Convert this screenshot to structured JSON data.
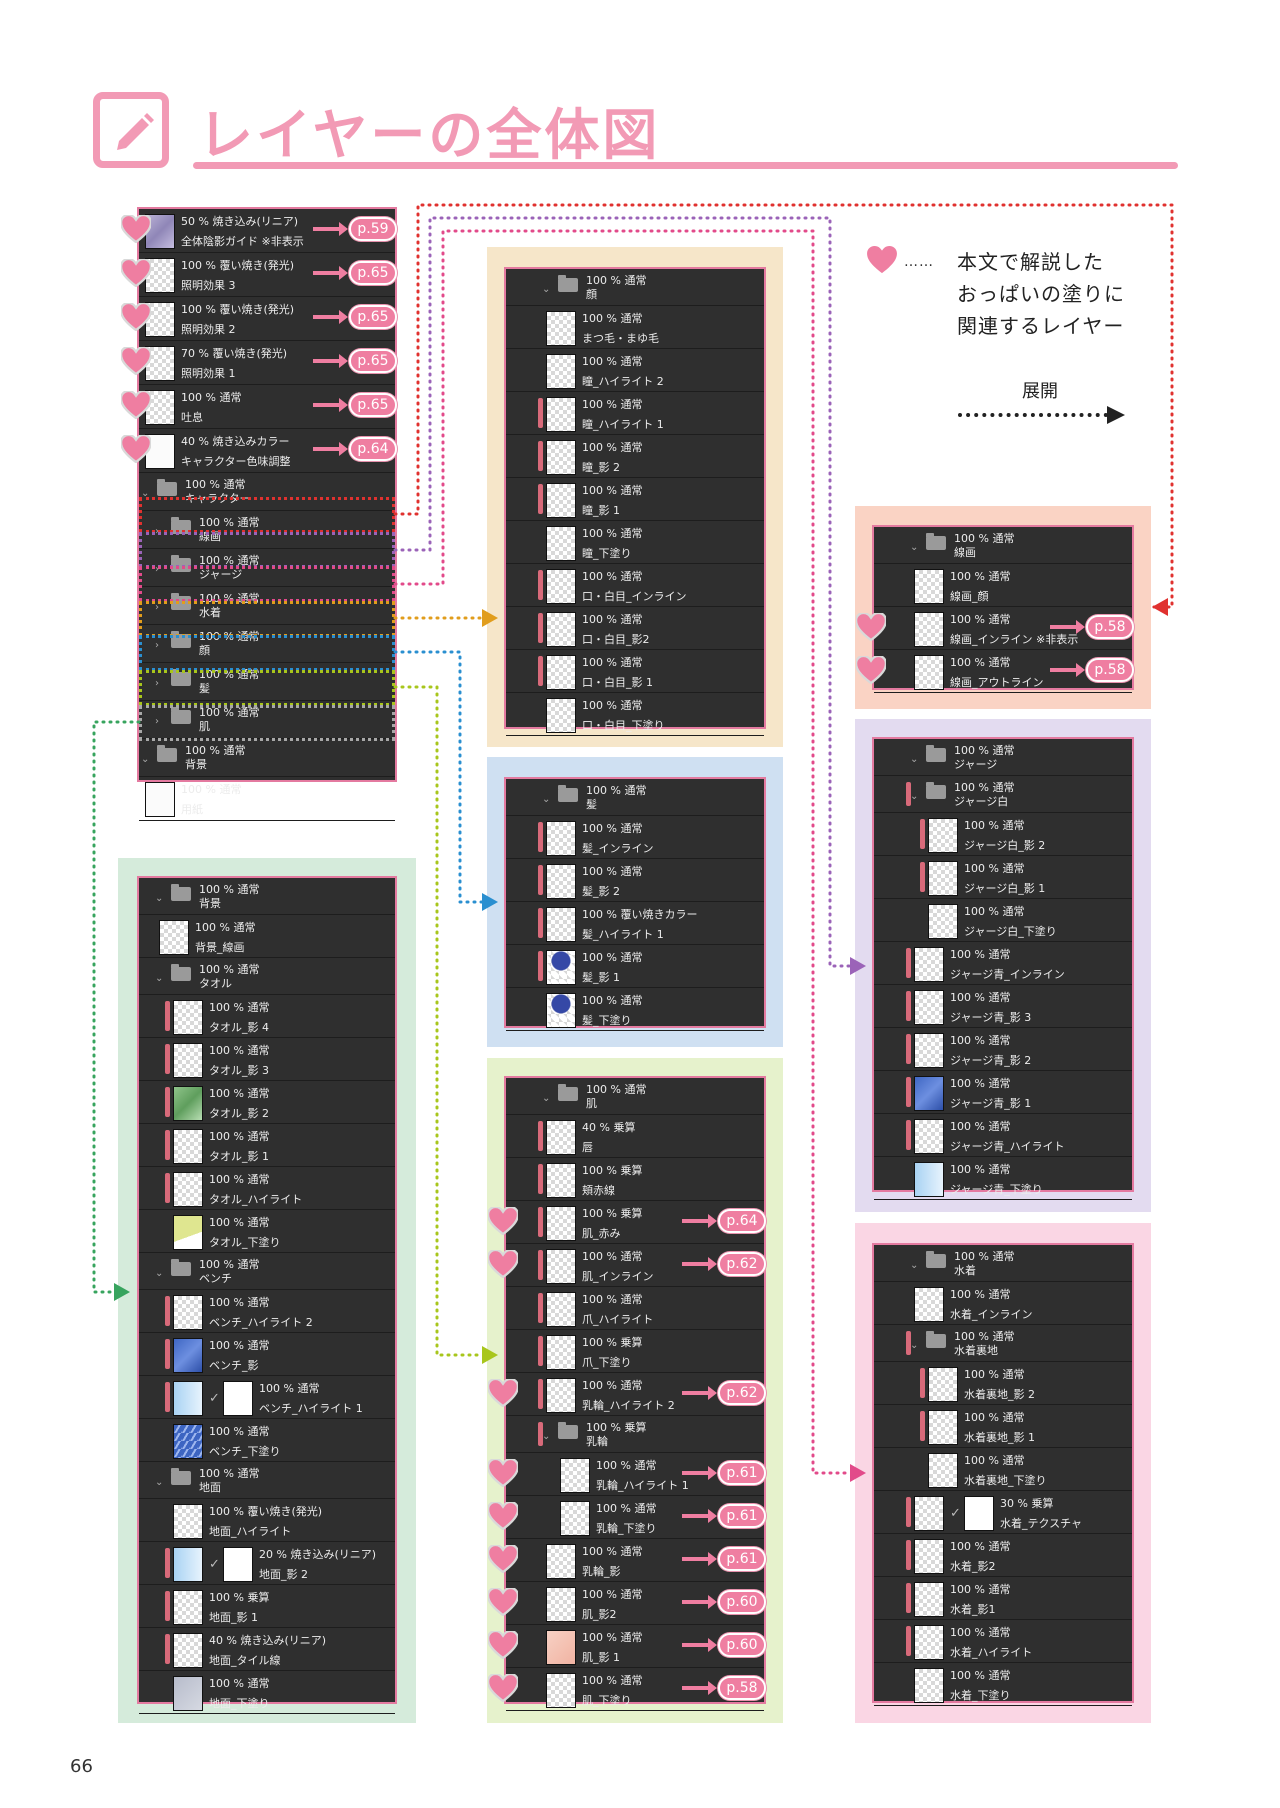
{
  "page": {
    "title": "レイヤーの全体図",
    "page_number": "66"
  },
  "legend": {
    "heart_icon": "heart-icon",
    "dots": "……",
    "lines": [
      "本文で解説した",
      "おっぱいの塗りに",
      "関連するレイヤー"
    ],
    "expand_label": "展開"
  },
  "colors": {
    "accent_pink": "#f29ab5",
    "panel_bg": "#2f2f2f",
    "clip_mark": "#d86a7a",
    "conn_senga": "#e0312f",
    "conn_jersey": "#9b63b8",
    "conn_mizugi": "#e24a8a",
    "conn_kao": "#e19d1c",
    "conn_kami": "#2a8fd0",
    "conn_hada": "#a8c61c",
    "conn_haikei": "#37a45e"
  },
  "main_panel": {
    "rows": [
      {
        "t1": "50 % 焼き込み(リニア)",
        "t2": "全体陰影ガイド ※非表示",
        "thumb": "lav",
        "heart": true,
        "ref": "p.59"
      },
      {
        "t1": "100 % 覆い焼き(発光)",
        "t2": "照明効果 3",
        "thumb": "check",
        "heart": true,
        "ref": "p.65"
      },
      {
        "t1": "100 % 覆い焼き(発光)",
        "t2": "照明効果 2",
        "thumb": "check",
        "heart": true,
        "ref": "p.65"
      },
      {
        "t1": "70 % 覆い焼き(発光)",
        "t2": "照明効果 1",
        "thumb": "check",
        "heart": true,
        "ref": "p.65"
      },
      {
        "t1": "100 % 通常",
        "t2": "吐息",
        "thumb": "check",
        "heart": true,
        "ref": "p.65"
      },
      {
        "t1": "40 % 焼き込みカラー",
        "t2": "キャラクター色味調整",
        "thumb": "white",
        "heart": true,
        "ref": "p.64"
      },
      {
        "t1": "100 % 通常",
        "t2": "キャラクター",
        "folder": true,
        "open": true
      },
      {
        "t1": "100 % 通常",
        "t2": "線画",
        "folder": true,
        "sub": true
      },
      {
        "t1": "100 % 通常",
        "t2": "ジャージ",
        "folder": true,
        "sub": true
      },
      {
        "t1": "100 % 通常",
        "t2": "水着",
        "folder": true,
        "sub": true
      },
      {
        "t1": "100 % 通常",
        "t2": "顔",
        "folder": true,
        "sub": true
      },
      {
        "t1": "100 % 通常",
        "t2": "髪",
        "folder": true,
        "sub": true
      },
      {
        "t1": "100 % 通常",
        "t2": "肌",
        "folder": true,
        "sub": true
      },
      {
        "t1": "100 % 通常",
        "t2": "背景",
        "folder": true
      },
      {
        "t1": "100 % 通常",
        "t2": "用紙",
        "thumb": "white"
      }
    ]
  },
  "panels": {
    "kao": [
      {
        "t1": "100 % 通常",
        "t2": "顔",
        "folder": true
      },
      {
        "t1": "100 % 通常",
        "t2": "まつ毛・まゆ毛"
      },
      {
        "t1": "100 % 通常",
        "t2": "瞳_ハイライト 2"
      },
      {
        "t1": "100 % 通常",
        "t2": "瞳_ハイライト 1",
        "clip": true
      },
      {
        "t1": "100 % 通常",
        "t2": "瞳_影 2",
        "clip": true
      },
      {
        "t1": "100 % 通常",
        "t2": "瞳_影 1",
        "clip": true
      },
      {
        "t1": "100 % 通常",
        "t2": "瞳_下塗り"
      },
      {
        "t1": "100 % 通常",
        "t2": "口・白目_インライン",
        "clip": true
      },
      {
        "t1": "100 % 通常",
        "t2": "口・白目_影2",
        "clip": true
      },
      {
        "t1": "100 % 通常",
        "t2": "口・白目_影 1",
        "clip": true
      },
      {
        "t1": "100 % 通常",
        "t2": "口・白目_下塗り"
      }
    ],
    "kami": [
      {
        "t1": "100 % 通常",
        "t2": "髪",
        "folder": true
      },
      {
        "t1": "100 % 通常",
        "t2": "髪_インライン",
        "clip": true
      },
      {
        "t1": "100 % 通常",
        "t2": "髪_影 2",
        "clip": true
      },
      {
        "t1": "100 % 覆い焼きカラー",
        "t2": "髪_ハイライト 1",
        "clip": true
      },
      {
        "t1": "100 % 通常",
        "t2": "髪_影 1",
        "clip": true,
        "thumb": "hair"
      },
      {
        "t1": "100 % 通常",
        "t2": "髪_下塗り",
        "thumb": "hair"
      }
    ],
    "hada": [
      {
        "t1": "100 % 通常",
        "t2": "肌",
        "folder": true
      },
      {
        "t1": "40 % 乗算",
        "t2": "唇",
        "clip": true
      },
      {
        "t1": "100 % 乗算",
        "t2": "頬赤線",
        "clip": true
      },
      {
        "t1": "100 % 乗算",
        "t2": "肌_赤み",
        "clip": true,
        "heart": true,
        "ref": "p.64"
      },
      {
        "t1": "100 % 通常",
        "t2": "肌_インライン",
        "clip": true,
        "heart": true,
        "ref": "p.62"
      },
      {
        "t1": "100 % 通常",
        "t2": "爪_ハイライト",
        "clip": true
      },
      {
        "t1": "100 % 乗算",
        "t2": "爪_下塗り",
        "clip": true
      },
      {
        "t1": "100 % 通常",
        "t2": "乳輪_ハイライト 2",
        "clip": true,
        "heart": true,
        "ref": "p.62"
      },
      {
        "t1": "100 % 乗算",
        "t2": "乳輪",
        "folder": true,
        "clip": true
      },
      {
        "t1": "100 % 通常",
        "t2": "乳輪_ハイライト 1",
        "sub": true,
        "heart": true,
        "ref": "p.61"
      },
      {
        "t1": "100 % 通常",
        "t2": "乳輪_下塗り",
        "sub": true,
        "heart": true,
        "ref": "p.61"
      },
      {
        "t1": "100 % 通常",
        "t2": "乳輪_影",
        "heart": true,
        "ref": "p.61"
      },
      {
        "t1": "100 % 通常",
        "t2": "肌_影2",
        "heart": true,
        "ref": "p.60"
      },
      {
        "t1": "100 % 通常",
        "t2": "肌_影 1",
        "heart": true,
        "ref": "p.60",
        "thumb": "peach"
      },
      {
        "t1": "100 % 通常",
        "t2": "肌_下塗り",
        "heart": true,
        "ref": "p.58"
      }
    ],
    "senga": [
      {
        "t1": "100 % 通常",
        "t2": "線画",
        "folder": true
      },
      {
        "t1": "100 % 通常",
        "t2": "線画_顔"
      },
      {
        "t1": "100 % 通常",
        "t2": "線画_インライン ※非表示",
        "heart": true,
        "ref": "p.58"
      },
      {
        "t1": "100 % 通常",
        "t2": "線画_アウトライン",
        "heart": true,
        "ref": "p.58"
      }
    ],
    "jersey": [
      {
        "t1": "100 % 通常",
        "t2": "ジャージ",
        "folder": true
      },
      {
        "t1": "100 % 通常",
        "t2": "ジャージ白",
        "folder": true,
        "clip": true
      },
      {
        "t1": "100 % 通常",
        "t2": "ジャージ白_影 2",
        "clip": true,
        "sub": true
      },
      {
        "t1": "100 % 通常",
        "t2": "ジャージ白_影 1",
        "clip": true,
        "sub": true
      },
      {
        "t1": "100 % 通常",
        "t2": "ジャージ白_下塗り",
        "sub": true
      },
      {
        "t1": "100 % 通常",
        "t2": "ジャージ青_インライン",
        "clip": true
      },
      {
        "t1": "100 % 通常",
        "t2": "ジャージ青_影 3",
        "clip": true
      },
      {
        "t1": "100 % 通常",
        "t2": "ジャージ青_影 2",
        "clip": true
      },
      {
        "t1": "100 % 通常",
        "t2": "ジャージ青_影 1",
        "clip": true,
        "thumb": "blue"
      },
      {
        "t1": "100 % 通常",
        "t2": "ジャージ青_ハイライト",
        "clip": true
      },
      {
        "t1": "100 % 通常",
        "t2": "ジャージ青_下塗り",
        "thumb": "lightblue"
      }
    ],
    "mizugi": [
      {
        "t1": "100 % 通常",
        "t2": "水着",
        "folder": true
      },
      {
        "t1": "100 % 通常",
        "t2": "水着_インライン"
      },
      {
        "t1": "100 % 通常",
        "t2": "水着裏地",
        "folder": true,
        "clip": true
      },
      {
        "t1": "100 % 通常",
        "t2": "水着裏地_影 2",
        "clip": true,
        "sub": true
      },
      {
        "t1": "100 % 通常",
        "t2": "水着裏地_影 1",
        "clip": true,
        "sub": true
      },
      {
        "t1": "100 % 通常",
        "t2": "水着裏地_下塗り",
        "sub": true
      },
      {
        "t1": "30 % 乗算",
        "t2": "水着_テクスチャ",
        "clip": true,
        "mask": true
      },
      {
        "t1": "100 % 通常",
        "t2": "水着_影2",
        "clip": true
      },
      {
        "t1": "100 % 通常",
        "t2": "水着_影1",
        "clip": true
      },
      {
        "t1": "100 % 通常",
        "t2": "水着_ハイライト",
        "clip": true
      },
      {
        "t1": "100 % 通常",
        "t2": "水着_下塗り"
      }
    ],
    "haikei": [
      {
        "t1": "100 % 通常",
        "t2": "背景",
        "folder": true
      },
      {
        "t1": "100 % 通常",
        "t2": "背景_線画"
      },
      {
        "t1": "100 % 通常",
        "t2": "タオル",
        "folder": true
      },
      {
        "t1": "100 % 通常",
        "t2": "タオル_影 4",
        "clip": true,
        "sub": true
      },
      {
        "t1": "100 % 通常",
        "t2": "タオル_影 3",
        "clip": true,
        "sub": true
      },
      {
        "t1": "100 % 通常",
        "t2": "タオル_影 2",
        "clip": true,
        "sub": true,
        "thumb": "green"
      },
      {
        "t1": "100 % 通常",
        "t2": "タオル_影 1",
        "clip": true,
        "sub": true
      },
      {
        "t1": "100 % 通常",
        "t2": "タオル_ハイライト",
        "clip": true,
        "sub": true
      },
      {
        "t1": "100 % 通常",
        "t2": "タオル_下塗り",
        "sub": true,
        "thumb": "yellow"
      },
      {
        "t1": "100 % 通常",
        "t2": "ベンチ",
        "folder": true
      },
      {
        "t1": "100 % 通常",
        "t2": "ベンチ_ハイライト 2",
        "clip": true,
        "sub": true
      },
      {
        "t1": "100 % 通常",
        "t2": "ベンチ_影",
        "clip": true,
        "sub": true,
        "thumb": "blue"
      },
      {
        "t1": "100 % 通常",
        "t2": "ベンチ_ハイライト 1",
        "clip": true,
        "sub": true,
        "thumb": "lightblue",
        "mask": true
      },
      {
        "t1": "100 % 通常",
        "t2": "ベンチ_下塗り",
        "sub": true,
        "thumb": "stripe"
      },
      {
        "t1": "100 % 通常",
        "t2": "地面",
        "folder": true
      },
      {
        "t1": "100 % 覆い焼き(発光)",
        "t2": "地面_ハイライト",
        "sub": true
      },
      {
        "t1": "20 % 焼き込み(リニア)",
        "t2": "地面_影 2",
        "clip": true,
        "sub": true,
        "thumb": "lightblue",
        "mask": true
      },
      {
        "t1": "100 % 乗算",
        "t2": "地面_影 1",
        "clip": true,
        "sub": true
      },
      {
        "t1": "40 % 焼き込み(リニア)",
        "t2": "地面_タイル線",
        "clip": true,
        "sub": true
      },
      {
        "t1": "100 % 通常",
        "t2": "地面_下塗り",
        "sub": true,
        "thumb": "grey"
      }
    ]
  }
}
